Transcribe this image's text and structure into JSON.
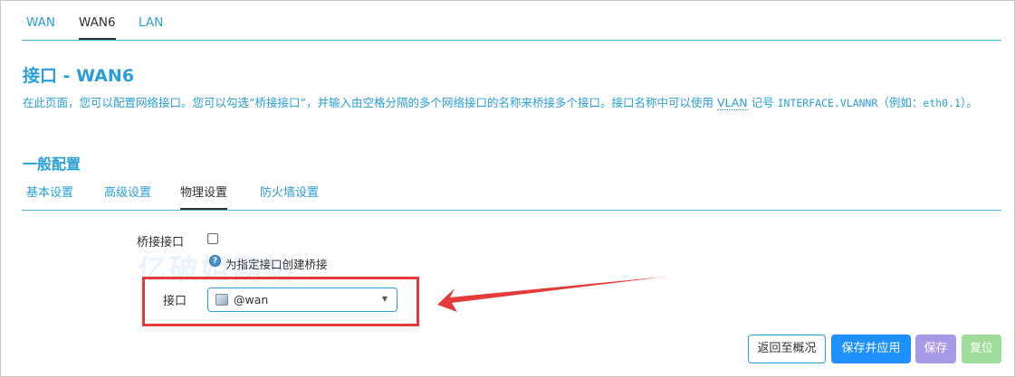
{
  "tabs": [
    "WAN",
    "WAN6",
    "LAN"
  ],
  "active_tab": "WAN6",
  "page_title": "接口 - WAN6",
  "description": {
    "part1": "在此页面，您可以配置网络接口。您可以勾选“桥接接口”，并输入由空格分隔的多个网络接口的名称来桥接多个接口。接口名称中可以使用 ",
    "vlan": "VLAN",
    "part2": " 记号 ",
    "code1": "INTERFACE.VLANNR",
    "part3": "（例如：",
    "code2": "eth0.1",
    "part4": "）。"
  },
  "section_title": "一般配置",
  "sub_tabs": [
    "基本设置",
    "高级设置",
    "物理设置",
    "防火墙设置"
  ],
  "active_sub_tab": "物理设置",
  "bridge": {
    "label": "桥接接口",
    "checked": false,
    "hint": "为指定接口创建桥接"
  },
  "interface": {
    "label": "接口",
    "value": "@wan"
  },
  "watermark": "亿破姐网站",
  "buttons": {
    "back": "返回至概况",
    "save_apply": "保存并应用",
    "save": "保存",
    "reset": "复位"
  },
  "colors": {
    "accent": "#2a9fd6",
    "annotation": "#e53a3a",
    "apply": "#1e90ff",
    "save": "#a99ae8",
    "reset": "#9fdc9a"
  }
}
